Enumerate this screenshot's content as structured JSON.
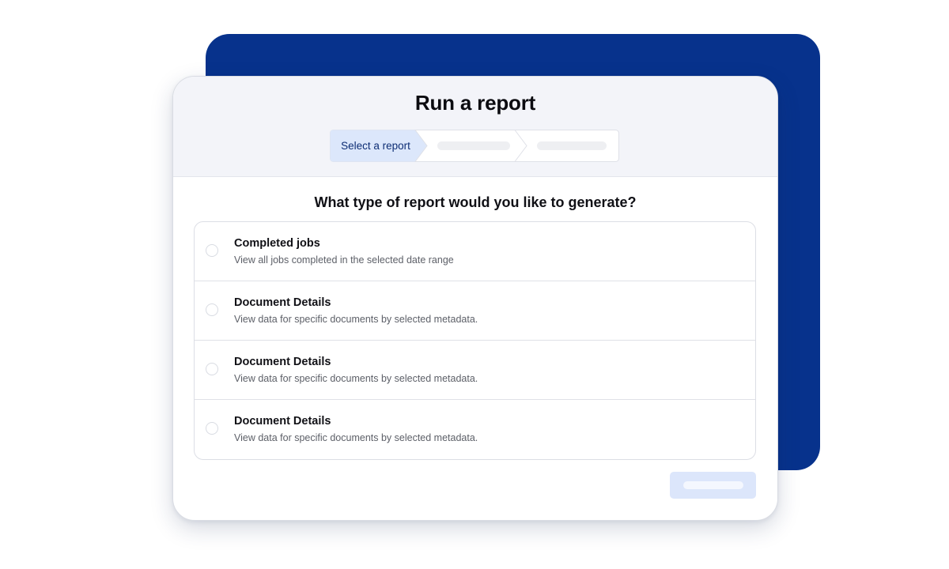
{
  "modal": {
    "title": "Run a report",
    "stepper": {
      "active_step_label": "Select a report",
      "active_fill": "#dce7fb",
      "active_text_color": "#0d2d74"
    },
    "question": "What type of report would you like to generate?",
    "options": [
      {
        "title": "Completed jobs",
        "description": "View all jobs completed in the selected date range"
      },
      {
        "title": "Document Details",
        "description": "View data for specific documents by selected metadata."
      },
      {
        "title": "Document Details",
        "description": "View data for specific documents by selected metadata."
      },
      {
        "title": "Document Details",
        "description": "View data for specific documents by selected metadata."
      }
    ]
  },
  "colors": {
    "backdrop": "#07328c",
    "header_bg": "#f3f4f9",
    "button_bg": "#dce6fb"
  }
}
